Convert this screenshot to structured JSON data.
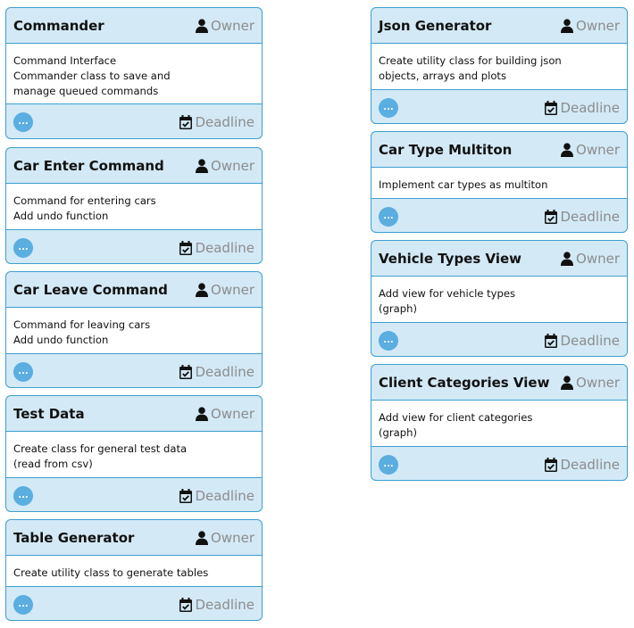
{
  "labels": {
    "owner": "Owner",
    "deadline": "Deadline",
    "more": "..."
  },
  "left_cards": [
    {
      "title": "Commander",
      "lines": [
        "Command Interface",
        "Commander class to save and",
        "manage queued commands"
      ]
    },
    {
      "title": "Car Enter Command",
      "lines": [
        "Command for entering cars",
        "Add undo function"
      ]
    },
    {
      "title": "Car Leave Command",
      "lines": [
        "Command for leaving cars",
        "Add undo function"
      ]
    },
    {
      "title": "Test Data",
      "lines": [
        "Create class for general test data",
        "(read from csv)"
      ]
    },
    {
      "title": "Table Generator",
      "lines": [
        "Create utility class to generate tables"
      ]
    }
  ],
  "right_cards": [
    {
      "title": "Json Generator",
      "lines": [
        "Create utility class for building json",
        "objects, arrays and plots"
      ]
    },
    {
      "title": "Car Type Multiton",
      "lines": [
        "Implement car types as multiton"
      ]
    },
    {
      "title": "Vehicle Types View",
      "lines": [
        "Add view for vehicle types",
        "(graph)"
      ]
    },
    {
      "title": "Client Categories View",
      "lines": [
        "Add view for client categories",
        "(graph)"
      ]
    }
  ],
  "colors": {
    "border": "#3d9fcf",
    "card_bg": "#d3e9f6",
    "button": "#5aaee0",
    "muted_text": "#8c8c8c"
  },
  "icons": {
    "owner": "user-icon",
    "deadline": "calendar-check-icon"
  }
}
